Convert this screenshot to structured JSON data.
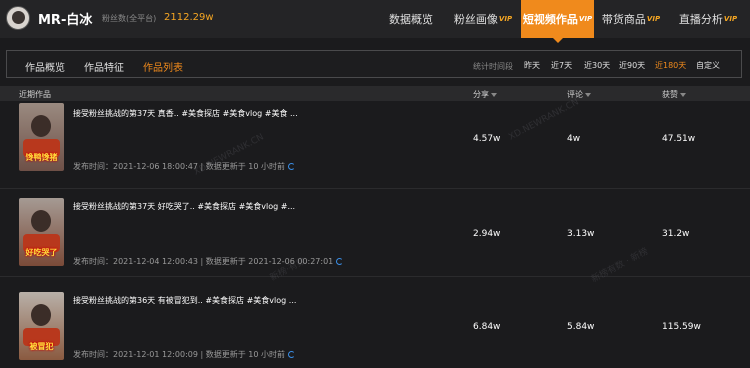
{
  "header": {
    "username": "MR-白冰",
    "fans_label": "粉丝数(全平台)",
    "fans_value": "2112.29w",
    "nav": [
      {
        "label": "数据概览",
        "vip": ""
      },
      {
        "label": "粉丝画像",
        "vip": "VIP"
      },
      {
        "label": "短视频作品",
        "vip": "VIP"
      },
      {
        "label": "带货商品",
        "vip": "VIP"
      },
      {
        "label": "直播分析",
        "vip": "VIP"
      }
    ]
  },
  "subtabs": [
    "作品概览",
    "作品特征",
    "作品列表"
  ],
  "time_filter": {
    "label": "统计时间段",
    "ranges": [
      "昨天",
      "近7天",
      "近30天",
      "近90天",
      "近180天",
      "自定义"
    ]
  },
  "table": {
    "headers": [
      "近期作品",
      "分享",
      "评论",
      "获赞"
    ],
    "rows": [
      {
        "title": "接受粉丝挑战的第37天 真香.. #美食探店 #美食vlog #美食 ...",
        "thumb_caption": "馋鸭馋猪",
        "meta": "发布时间：2021-12-06 18:00:47  |  数据更新于 10 小时前",
        "share": "4.57w",
        "comment": "4w",
        "likes": "47.51w"
      },
      {
        "title": "接受粉丝挑战的第37天 好吃哭了.. #美食探店 #美食vlog #...",
        "thumb_caption": "好吃哭了",
        "meta": "发布时间：2021-12-04 12:00:43  |  数据更新于 2021-12-06 00:27:01",
        "share": "2.94w",
        "comment": "3.13w",
        "likes": "31.2w"
      },
      {
        "title": "接受粉丝挑战的第36天 有被冒犯到.. #美食探店 #美食vlog ...",
        "thumb_caption": "被冒犯",
        "meta": "发布时间：2021-12-01 12:00:09  |  数据更新于 10 小时前",
        "share": "6.84w",
        "comment": "5.84w",
        "likes": "115.59w"
      }
    ]
  },
  "watermarks": [
    "XD.NEWRANK.CN",
    "新榜·有数",
    "XD.NEWRANK.CN",
    "新榜有数 · 新榜"
  ],
  "colors": {
    "accent": "#f08a1c",
    "vip": "#f5a623",
    "refresh": "#3a8ee6"
  }
}
